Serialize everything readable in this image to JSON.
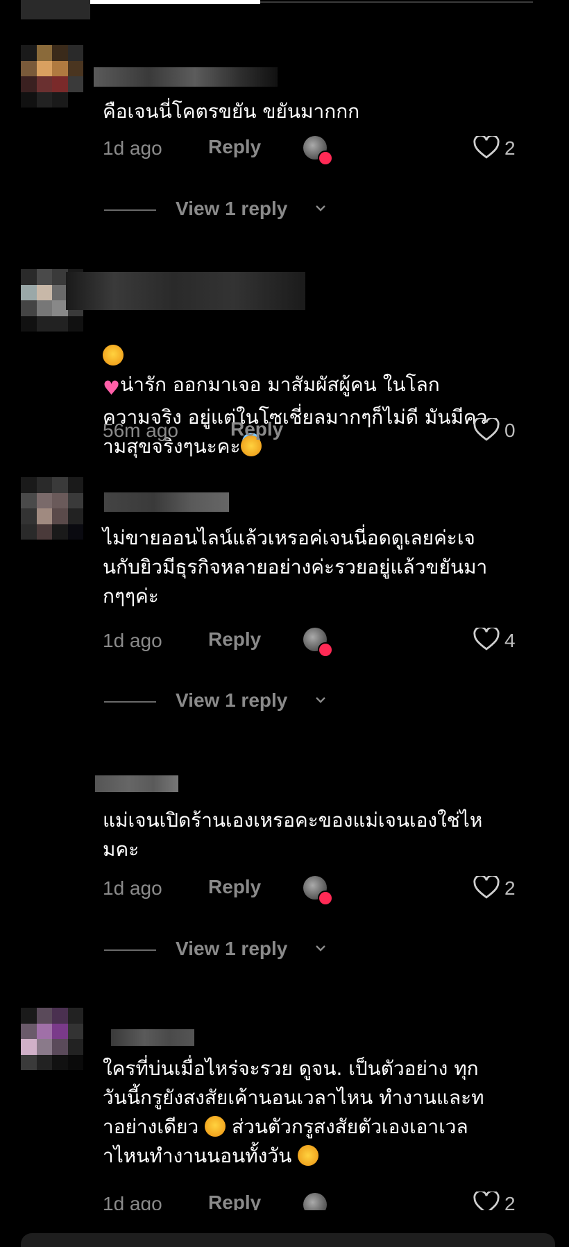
{
  "comments": [
    {
      "text": "คือเจนนี่โคตรขยัน ขยันมากกก",
      "time": "1d ago",
      "reply_label": "Reply",
      "likes": "2",
      "view_replies": "View 1 reply"
    },
    {
      "text_prefix": "",
      "text": "น่ารัก ออกมาเจอ มาสัมผัสผู้คน ในโลก\nความจริง อยู่แต่ในโซเชี่ยลมากๆก็ไม่ดี มันมีคว\nามสุขจริงๆนะคะ",
      "time": "56m ago",
      "reply_label": "Reply",
      "likes": "0"
    },
    {
      "text": "ไม่ขายออนไลน์แล้วเหรอค่เจนนี่อดดูเลยค่ะเจ\nนกับยิวมีธุรกิจหลายอย่างค่ะรวยอยู่แล้วขยันมา\nกๆๆค่ะ",
      "time": "1d ago",
      "reply_label": "Reply",
      "likes": "4",
      "view_replies": "View 1 reply"
    },
    {
      "text": "แม่เจนเปิดร้านเองเหรอคะของแม่เจนเองใช่ไห\nมคะ",
      "time": "1d ago",
      "reply_label": "Reply",
      "likes": "2",
      "view_replies": "View 1 reply"
    },
    {
      "text_a": "ใครที่บ่นเมื่อไหร่จะรวย ดูจน. เป็นตัวอย่าง ทุก\nวันนี้กรูยังสงสัยเค้านอนเวลาไหน ทำงานและท\nาอย่างเดียว ",
      "text_b": " ส่วนตัวกรูสงสัยตัวเองเอาเวล\nาไหนทำงานนอนทั้งวัน ",
      "time": "1d ago",
      "reply_label": "Reply",
      "likes": "2"
    }
  ],
  "icons": {
    "heart": "heart-outline-icon",
    "chevron": "chevron-down-icon"
  },
  "colors": {
    "background": "#000000",
    "muted": "#8a8a8a",
    "badge": "#ff2a55"
  }
}
